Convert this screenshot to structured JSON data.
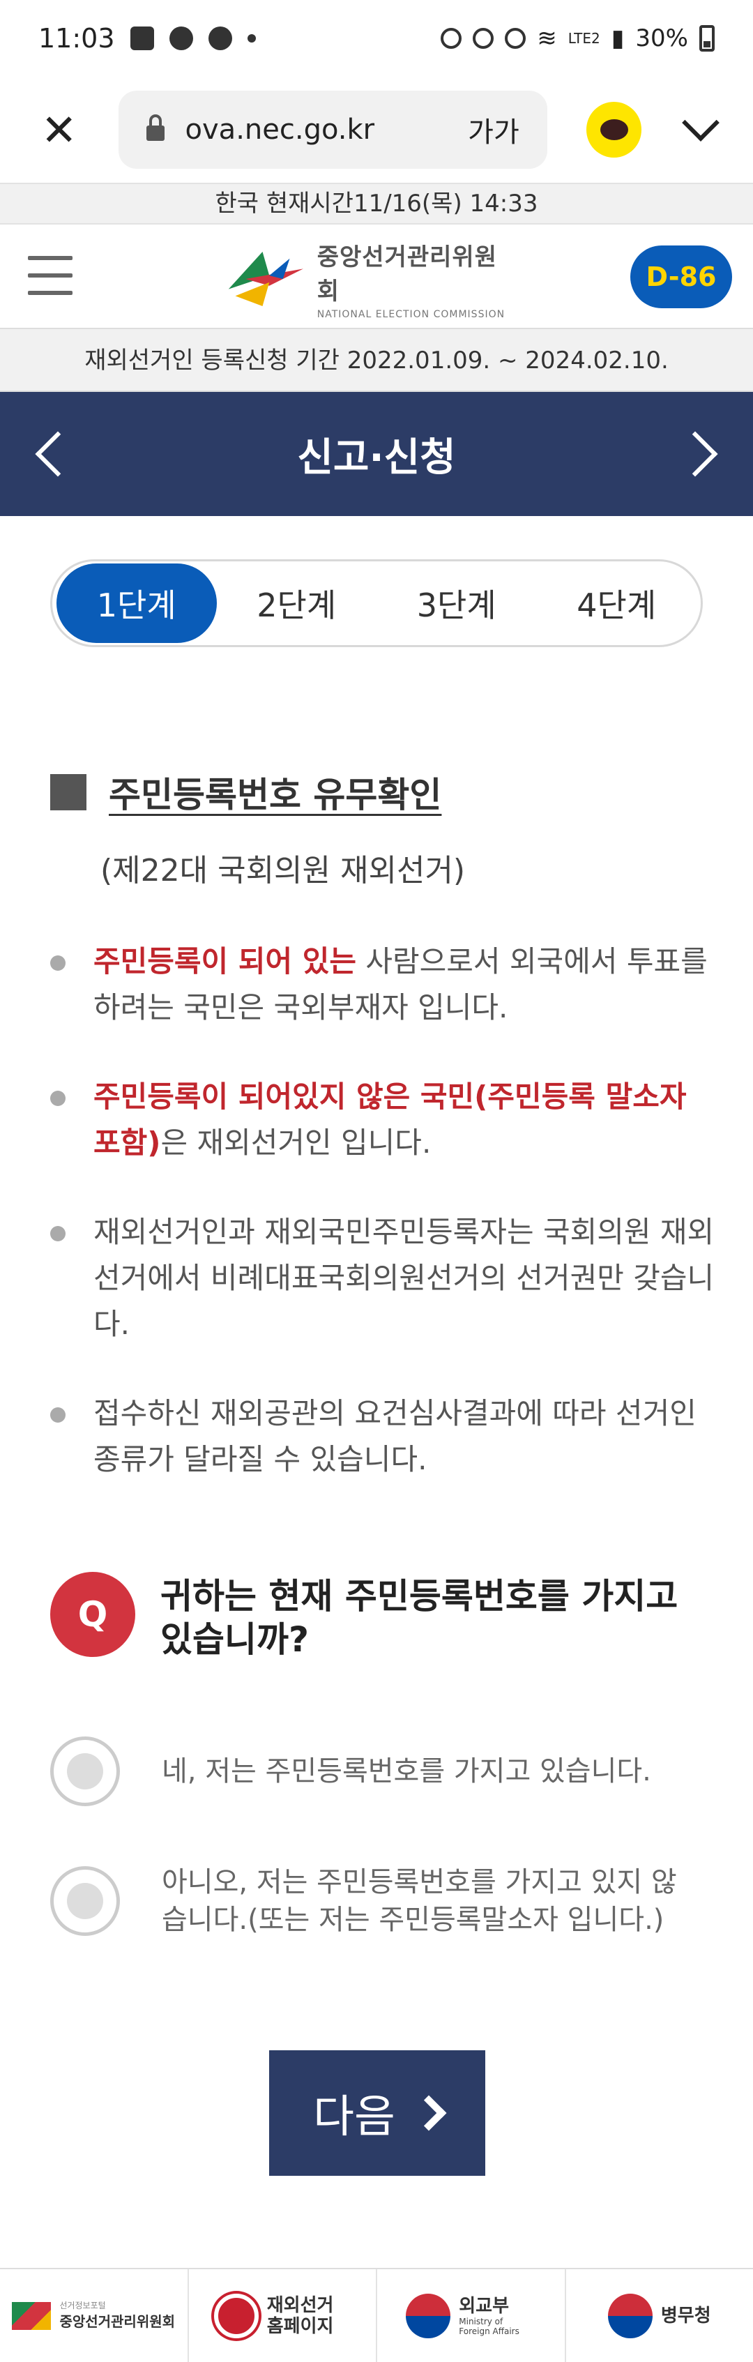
{
  "status": {
    "time": "11:03",
    "battery": "30%",
    "network": "LTE2"
  },
  "browser": {
    "url": "ova.nec.go.kr",
    "text_size_label": "가가"
  },
  "time_bar": "한국 현재시간11/16(목) 14:33",
  "header": {
    "logo_ko": "중앙선거관리위원회",
    "logo_en": "NATIONAL ELECTION COMMISSION",
    "dday": "D-86"
  },
  "notice": "재외선거인 등록신청 기간 2022.01.09. ~ 2024.02.10.",
  "nav": {
    "title": "신고·신청"
  },
  "steps": [
    "1단계",
    "2단계",
    "3단계",
    "4단계"
  ],
  "section": {
    "title": "주민등록번호 유무확인",
    "subtitle": "(제22대 국회의원 재외선거)"
  },
  "bullets": [
    {
      "highlight": "주민등록이 되어 있는",
      "text": " 사람으로서 외국에서 투표를 하려는 국민은 국외부재자 입니다."
    },
    {
      "highlight": "주민등록이 되어있지 않은 국민(주민등록 말소자 포함)",
      "text": "은 재외선거인 입니다."
    },
    {
      "highlight": "",
      "text": "재외선거인과 재외국민주민등록자는 국회의원 재외선거에서 비례대표국회의원선거의 선거권만 갖습니다."
    },
    {
      "highlight": "",
      "text": "접수하신 재외공관의 요건심사결과에 따라 선거인 종류가 달라질 수 있습니다."
    }
  ],
  "question": {
    "badge": "Q",
    "text": "귀하는 현재 주민등록번호를 가지고 있습니까?"
  },
  "options": [
    "네, 저는 주민등록번호를 가지고 있습니다.",
    "아니오, 저는 주민등록번호를 가지고 있지 않습니다.(또는 저는 주민등록말소자 입니다.)"
  ],
  "next_button": "다음",
  "footer": {
    "nec_small": "선거정보포털",
    "nec_main": "중앙선거관리위원회",
    "ova_main": "재외선거 홈페이지",
    "mofa_main": "외교부",
    "mofa_en": "Ministry of Foreign Affairs",
    "mma_main": "병무청"
  },
  "colors": {
    "primary_blue": "#0a5cb8",
    "navy": "#2c3c66",
    "highlight_red": "#c0262d",
    "q_red": "#d2343f",
    "dday_yellow": "#ffd400"
  }
}
